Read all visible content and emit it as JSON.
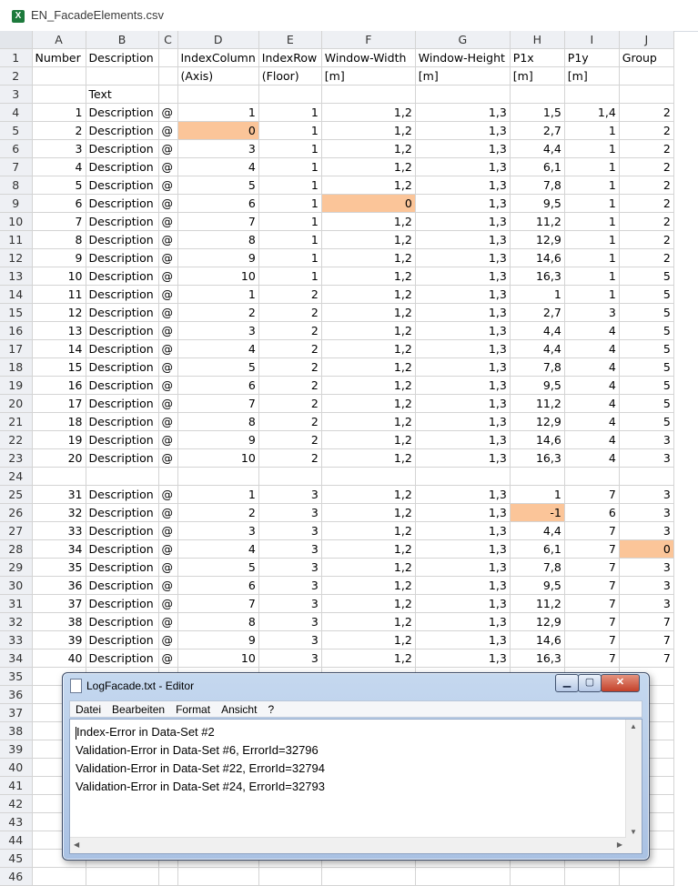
{
  "window": {
    "title": "EN_FacadeElements.csv",
    "icon": "excel-file-icon"
  },
  "columns": [
    "A",
    "B",
    "C",
    "D",
    "E",
    "F",
    "G",
    "H",
    "I",
    "J"
  ],
  "rows": [
    {
      "n": "1",
      "cells": [
        "Number",
        "Description",
        "",
        "IndexColumn",
        "IndexRow",
        "Window-Width",
        "Window-Height",
        "P1x",
        "P1y",
        "Group"
      ],
      "type": "text"
    },
    {
      "n": "2",
      "cells": [
        "",
        "",
        "",
        "(Axis)",
        "(Floor)",
        "[m]",
        "[m]",
        "[m]",
        "[m]",
        ""
      ],
      "type": "text"
    },
    {
      "n": "3",
      "cells": [
        "",
        "Text",
        "",
        "",
        "",
        "",
        "",
        "",
        "",
        ""
      ],
      "type": "text"
    },
    {
      "n": "4",
      "cells": [
        "1",
        "Description",
        "@",
        "1",
        "1",
        "1,2",
        "1,3",
        "1,5",
        "1,4",
        "2"
      ]
    },
    {
      "n": "5",
      "cells": [
        "2",
        "Description",
        "@",
        "0",
        "1",
        "1,2",
        "1,3",
        "2,7",
        "1",
        "2"
      ],
      "hl": [
        3
      ]
    },
    {
      "n": "6",
      "cells": [
        "3",
        "Description",
        "@",
        "3",
        "1",
        "1,2",
        "1,3",
        "4,4",
        "1",
        "2"
      ]
    },
    {
      "n": "7",
      "cells": [
        "4",
        "Description",
        "@",
        "4",
        "1",
        "1,2",
        "1,3",
        "6,1",
        "1",
        "2"
      ]
    },
    {
      "n": "8",
      "cells": [
        "5",
        "Description",
        "@",
        "5",
        "1",
        "1,2",
        "1,3",
        "7,8",
        "1",
        "2"
      ]
    },
    {
      "n": "9",
      "cells": [
        "6",
        "Description",
        "@",
        "6",
        "1",
        "0",
        "1,3",
        "9,5",
        "1",
        "2"
      ],
      "hl": [
        5
      ]
    },
    {
      "n": "10",
      "cells": [
        "7",
        "Description",
        "@",
        "7",
        "1",
        "1,2",
        "1,3",
        "11,2",
        "1",
        "2"
      ]
    },
    {
      "n": "11",
      "cells": [
        "8",
        "Description",
        "@",
        "8",
        "1",
        "1,2",
        "1,3",
        "12,9",
        "1",
        "2"
      ]
    },
    {
      "n": "12",
      "cells": [
        "9",
        "Description",
        "@",
        "9",
        "1",
        "1,2",
        "1,3",
        "14,6",
        "1",
        "2"
      ]
    },
    {
      "n": "13",
      "cells": [
        "10",
        "Description",
        "@",
        "10",
        "1",
        "1,2",
        "1,3",
        "16,3",
        "1",
        "5"
      ]
    },
    {
      "n": "14",
      "cells": [
        "11",
        "Description",
        "@",
        "1",
        "2",
        "1,2",
        "1,3",
        "1",
        "1",
        "5"
      ]
    },
    {
      "n": "15",
      "cells": [
        "12",
        "Description",
        "@",
        "2",
        "2",
        "1,2",
        "1,3",
        "2,7",
        "3",
        "5"
      ]
    },
    {
      "n": "16",
      "cells": [
        "13",
        "Description",
        "@",
        "3",
        "2",
        "1,2",
        "1,3",
        "4,4",
        "4",
        "5"
      ]
    },
    {
      "n": "17",
      "cells": [
        "14",
        "Description",
        "@",
        "4",
        "2",
        "1,2",
        "1,3",
        "4,4",
        "4",
        "5"
      ]
    },
    {
      "n": "18",
      "cells": [
        "15",
        "Description",
        "@",
        "5",
        "2",
        "1,2",
        "1,3",
        "7,8",
        "4",
        "5"
      ]
    },
    {
      "n": "19",
      "cells": [
        "16",
        "Description",
        "@",
        "6",
        "2",
        "1,2",
        "1,3",
        "9,5",
        "4",
        "5"
      ]
    },
    {
      "n": "20",
      "cells": [
        "17",
        "Description",
        "@",
        "7",
        "2",
        "1,2",
        "1,3",
        "11,2",
        "4",
        "5"
      ]
    },
    {
      "n": "21",
      "cells": [
        "18",
        "Description",
        "@",
        "8",
        "2",
        "1,2",
        "1,3",
        "12,9",
        "4",
        "5"
      ]
    },
    {
      "n": "22",
      "cells": [
        "19",
        "Description",
        "@",
        "9",
        "2",
        "1,2",
        "1,3",
        "14,6",
        "4",
        "3"
      ]
    },
    {
      "n": "23",
      "cells": [
        "20",
        "Description",
        "@",
        "10",
        "2",
        "1,2",
        "1,3",
        "16,3",
        "4",
        "3"
      ]
    },
    {
      "n": "24",
      "cells": [
        "",
        "",
        "",
        "",
        "",
        "",
        "",
        "",
        "",
        ""
      ]
    },
    {
      "n": "25",
      "cells": [
        "31",
        "Description",
        "@",
        "1",
        "3",
        "1,2",
        "1,3",
        "1",
        "7",
        "3"
      ]
    },
    {
      "n": "26",
      "cells": [
        "32",
        "Description",
        "@",
        "2",
        "3",
        "1,2",
        "1,3",
        "-1",
        "6",
        "3"
      ],
      "hl": [
        7
      ]
    },
    {
      "n": "27",
      "cells": [
        "33",
        "Description",
        "@",
        "3",
        "3",
        "1,2",
        "1,3",
        "4,4",
        "7",
        "3"
      ]
    },
    {
      "n": "28",
      "cells": [
        "34",
        "Description",
        "@",
        "4",
        "3",
        "1,2",
        "1,3",
        "6,1",
        "7",
        "0"
      ],
      "hl": [
        9
      ]
    },
    {
      "n": "29",
      "cells": [
        "35",
        "Description",
        "@",
        "5",
        "3",
        "1,2",
        "1,3",
        "7,8",
        "7",
        "3"
      ]
    },
    {
      "n": "30",
      "cells": [
        "36",
        "Description",
        "@",
        "6",
        "3",
        "1,2",
        "1,3",
        "9,5",
        "7",
        "3"
      ]
    },
    {
      "n": "31",
      "cells": [
        "37",
        "Description",
        "@",
        "7",
        "3",
        "1,2",
        "1,3",
        "11,2",
        "7",
        "3"
      ]
    },
    {
      "n": "32",
      "cells": [
        "38",
        "Description",
        "@",
        "8",
        "3",
        "1,2",
        "1,3",
        "12,9",
        "7",
        "7"
      ]
    },
    {
      "n": "33",
      "cells": [
        "39",
        "Description",
        "@",
        "9",
        "3",
        "1,2",
        "1,3",
        "14,6",
        "7",
        "7"
      ]
    },
    {
      "n": "34",
      "cells": [
        "40",
        "Description",
        "@",
        "10",
        "3",
        "1,2",
        "1,3",
        "16,3",
        "7",
        "7"
      ]
    },
    {
      "n": "35",
      "cells": [
        "",
        "",
        "",
        "",
        "",
        "",
        "",
        "",
        "",
        ""
      ]
    },
    {
      "n": "36",
      "cells": [
        "",
        "",
        "",
        "",
        "",
        "",
        "",
        "",
        "",
        ""
      ]
    },
    {
      "n": "37",
      "cells": [
        "",
        "",
        "",
        "",
        "",
        "",
        "",
        "",
        "",
        ""
      ]
    },
    {
      "n": "38",
      "cells": [
        "",
        "",
        "",
        "",
        "",
        "",
        "",
        "",
        "",
        ""
      ]
    },
    {
      "n": "39",
      "cells": [
        "",
        "",
        "",
        "",
        "",
        "",
        "",
        "",
        "",
        ""
      ]
    },
    {
      "n": "40",
      "cells": [
        "",
        "",
        "",
        "",
        "",
        "",
        "",
        "",
        "",
        ""
      ]
    },
    {
      "n": "41",
      "cells": [
        "",
        "",
        "",
        "",
        "",
        "",
        "",
        "",
        "",
        ""
      ]
    },
    {
      "n": "42",
      "cells": [
        "",
        "",
        "",
        "",
        "",
        "",
        "",
        "",
        "",
        ""
      ]
    },
    {
      "n": "43",
      "cells": [
        "",
        "",
        "",
        "",
        "",
        "",
        "",
        "",
        "",
        ""
      ]
    },
    {
      "n": "44",
      "cells": [
        "",
        "",
        "",
        "",
        "",
        "",
        "",
        "",
        "",
        ""
      ]
    },
    {
      "n": "45",
      "cells": [
        "",
        "",
        "",
        "",
        "",
        "",
        "",
        "",
        "",
        ""
      ]
    },
    {
      "n": "46",
      "cells": [
        "",
        "",
        "",
        "",
        "",
        "",
        "",
        "",
        "",
        ""
      ]
    }
  ],
  "highlight_color": "#fbc599",
  "notepad": {
    "title": "LogFacade.txt - Editor",
    "menu": [
      "Datei",
      "Bearbeiten",
      "Format",
      "Ansicht",
      "?"
    ],
    "lines": [
      "Index-Error in Data-Set #2",
      "Validation-Error in Data-Set #6, ErrorId=32796",
      "Validation-Error in Data-Set #22, ErrorId=32794",
      "Validation-Error in Data-Set #24, ErrorId=32793"
    ],
    "buttons": {
      "minimize": "▁",
      "maximize": "▢",
      "close": "✕"
    }
  }
}
